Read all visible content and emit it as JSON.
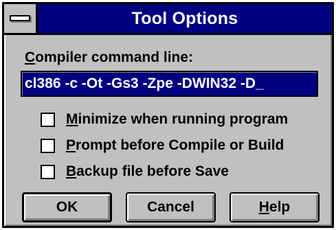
{
  "window": {
    "title": "Tool Options"
  },
  "compiler": {
    "label_mnemonic": "C",
    "label_rest": "ompiler command line:",
    "value": "cl386 -c -Ot -Gs3 -Zpe -DWIN32 -D_"
  },
  "options": [
    {
      "mnemonic": "M",
      "rest": "inimize when running program",
      "checked": false
    },
    {
      "mnemonic": "P",
      "rest": "rompt before Compile or Build",
      "checked": false
    },
    {
      "mnemonic": "B",
      "rest": "ackup file before Save",
      "checked": false
    }
  ],
  "buttons": {
    "ok": "OK",
    "cancel": "Cancel",
    "help_mnemonic": "H",
    "help_rest": "elp"
  },
  "colors": {
    "title_bar": "#000080",
    "face": "#c0c0c0",
    "selection": "#000080"
  },
  "icons": {
    "system_menu": "system-menu-bar-icon"
  }
}
